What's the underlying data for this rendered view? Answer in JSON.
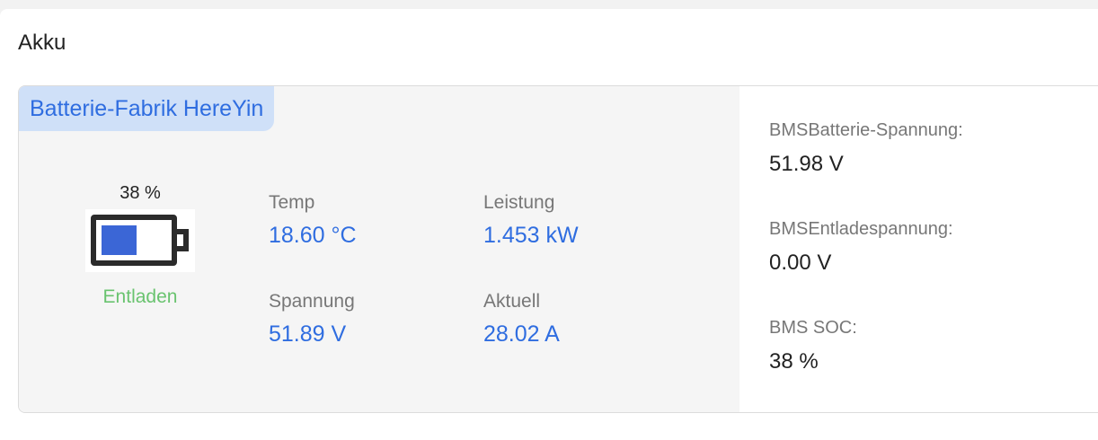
{
  "card": {
    "title": "Akku"
  },
  "battery_panel": {
    "factory": "Batterie-Fabrik HereYin",
    "soc_text": "38 %",
    "soc_fraction": 0.38,
    "status": "Entladen",
    "colors": {
      "accent": "#2f6de0",
      "status": "#69c36f",
      "battery_fill": "#3b66d6"
    },
    "metrics": {
      "temp": {
        "label": "Temp",
        "value": "18.60 °C"
      },
      "power": {
        "label": "Leistung",
        "value": "1.453 kW"
      },
      "voltage": {
        "label": "Spannung",
        "value": "51.89 V"
      },
      "current": {
        "label": "Aktuell",
        "value": "28.02 A"
      }
    }
  },
  "bms": {
    "items": [
      {
        "label": "BMSBatterie-Spannung:",
        "value": "51.98 V"
      },
      {
        "label": "BMSEntladespannung:",
        "value": "0.00 V"
      },
      {
        "label": "BMS SOC:",
        "value": "38 %"
      }
    ]
  }
}
